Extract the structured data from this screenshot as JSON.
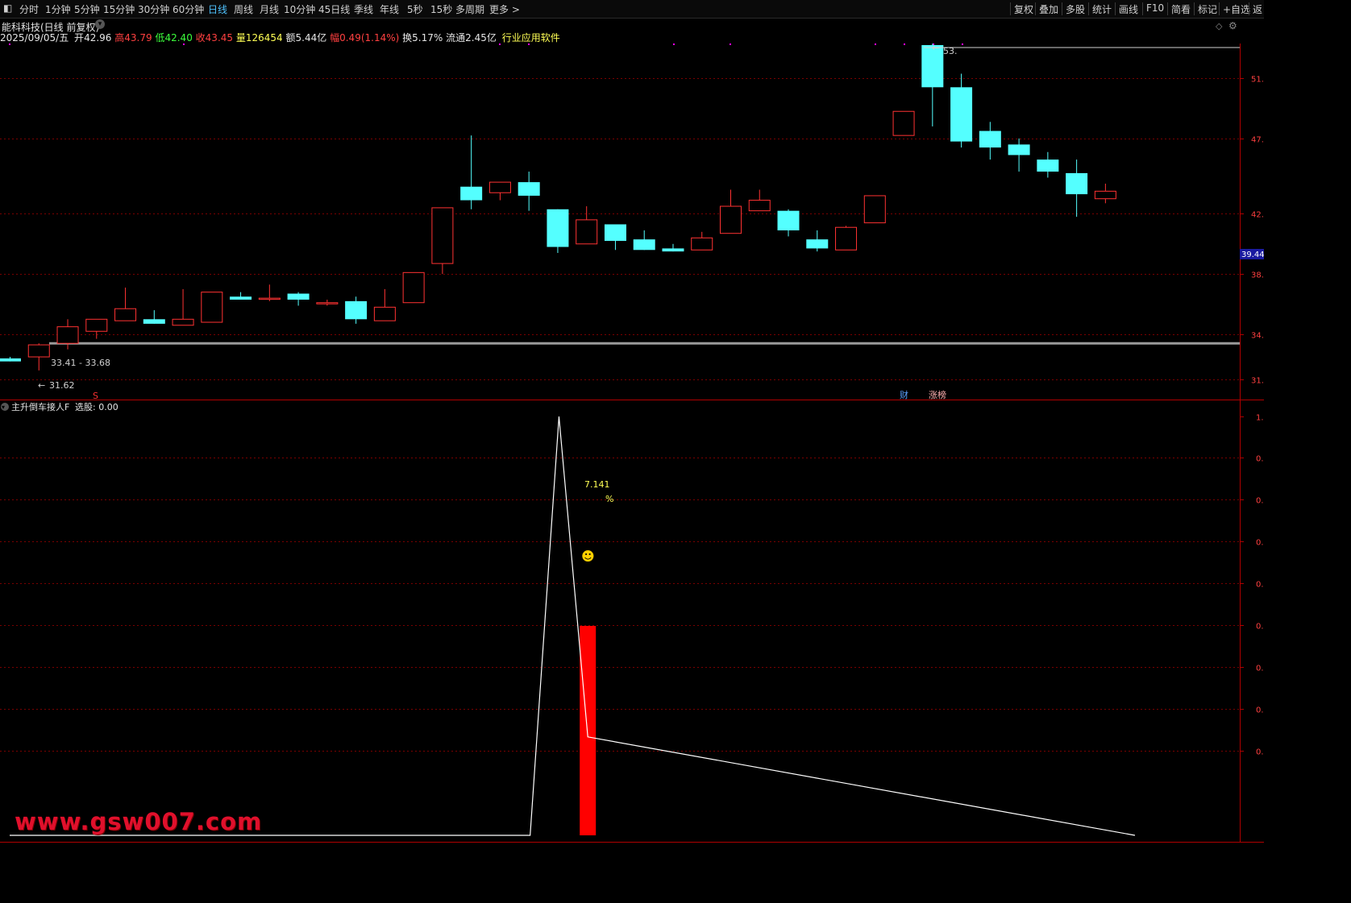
{
  "toolbar": {
    "menu_icon": "square-menu-icon",
    "periods": [
      "分时",
      "1分钟",
      "5分钟",
      "15分钟",
      "30分钟",
      "60分钟",
      "日线",
      "周线",
      "月线",
      "10分钟",
      "45日线",
      "季线",
      "年线",
      "5秒",
      "15秒",
      "多周期",
      "更多 >"
    ],
    "active_period": "日线",
    "right_buttons": [
      "复权",
      "叠加",
      "多股",
      "统计",
      "画线",
      "F10",
      "简看",
      "标记",
      "+自选",
      "返"
    ]
  },
  "header": {
    "stock_title": "能科科技(日线 前复权)",
    "date": "2025/09/05/五",
    "open_label": "开",
    "open": "42.96",
    "high_label": "高",
    "high": "43.79",
    "low_label": "低",
    "low": "42.40",
    "close_label": "收",
    "close": "43.45",
    "volume_label": "量",
    "volume": "126454",
    "amount_label": "额",
    "amount": "5.44亿",
    "change_label": "幅",
    "change": "0.49(1.14%)",
    "turnover_label": "换",
    "turnover": "5.17%",
    "float_label": "流通",
    "float": "2.45亿",
    "industry": "行业应用软件"
  },
  "main_panel": {
    "hline_label": "33.41 - 33.68",
    "low_marker": "31.62",
    "high_marker": "53.",
    "s_marker": "S",
    "cai_marker": "财",
    "zhangbang_marker": "涨榜",
    "current_price_tag": "39.44",
    "price_axis_labels": [
      "51.",
      "47.",
      "42.",
      "38.",
      "34.",
      "31."
    ]
  },
  "indicator": {
    "name": "主升倒车接人F",
    "select_label": "选股: 0.00",
    "value_label": "7.141",
    "percent_label": "%",
    "smiley": "☻",
    "axis_labels": [
      "1.",
      "0.",
      "0.",
      "0.",
      "0.",
      "0.",
      "0.",
      "0.",
      "0."
    ]
  },
  "watermark": "www.gsw007.com",
  "colors": {
    "up": "#ff3232",
    "down": "#54ffff",
    "bar": "#ff0000",
    "axis": "#b00000",
    "grid": "#7a0000",
    "indicator_line": "#ffffff",
    "label_yellow": "#ffff55"
  },
  "chart_data": [
    {
      "type": "candlestick",
      "title": "能科科技(日线 前复权)",
      "y_axis_ticks": [
        51,
        47,
        42,
        38,
        34,
        31
      ],
      "ylim": [
        31,
        53.3
      ],
      "horizontal_line": 33.4,
      "candles": [
        {
          "o": 32.4,
          "h": 32.5,
          "l": 32.2,
          "c": 32.2
        },
        {
          "o": 32.5,
          "h": 33.4,
          "l": 31.6,
          "c": 33.3
        },
        {
          "o": 33.4,
          "h": 35.0,
          "l": 33.0,
          "c": 34.5
        },
        {
          "o": 34.2,
          "h": 35.0,
          "l": 33.7,
          "c": 35.0
        },
        {
          "o": 34.9,
          "h": 37.1,
          "l": 34.9,
          "c": 35.7
        },
        {
          "o": 35.0,
          "h": 35.6,
          "l": 34.8,
          "c": 34.7
        },
        {
          "o": 34.6,
          "h": 37.0,
          "l": 34.6,
          "c": 35.0
        },
        {
          "o": 34.8,
          "h": 36.8,
          "l": 34.8,
          "c": 36.8
        },
        {
          "o": 36.5,
          "h": 36.8,
          "l": 36.3,
          "c": 36.3
        },
        {
          "o": 36.4,
          "h": 37.3,
          "l": 36.2,
          "c": 36.4
        },
        {
          "o": 36.7,
          "h": 36.8,
          "l": 35.9,
          "c": 36.3
        },
        {
          "o": 36.1,
          "h": 36.3,
          "l": 35.9,
          "c": 36.1
        },
        {
          "o": 36.2,
          "h": 36.5,
          "l": 34.7,
          "c": 35.0
        },
        {
          "o": 34.9,
          "h": 37.0,
          "l": 34.9,
          "c": 35.8
        },
        {
          "o": 36.1,
          "h": 38.1,
          "l": 36.1,
          "c": 38.1
        },
        {
          "o": 38.7,
          "h": 42.4,
          "l": 38.0,
          "c": 42.4
        },
        {
          "o": 43.8,
          "h": 47.2,
          "l": 42.3,
          "c": 42.9
        },
        {
          "o": 43.4,
          "h": 43.9,
          "l": 42.9,
          "c": 44.1
        },
        {
          "o": 44.1,
          "h": 44.8,
          "l": 42.2,
          "c": 43.2
        },
        {
          "o": 42.3,
          "h": 42.3,
          "l": 39.4,
          "c": 39.8
        },
        {
          "o": 40.0,
          "h": 42.5,
          "l": 40.1,
          "c": 41.6
        },
        {
          "o": 41.3,
          "h": 41.3,
          "l": 39.6,
          "c": 40.2
        },
        {
          "o": 40.3,
          "h": 40.9,
          "l": 39.8,
          "c": 39.6
        },
        {
          "o": 39.7,
          "h": 40.0,
          "l": 39.5,
          "c": 39.5
        },
        {
          "o": 39.6,
          "h": 40.8,
          "l": 39.6,
          "c": 40.4
        },
        {
          "o": 40.7,
          "h": 43.6,
          "l": 40.7,
          "c": 42.5
        },
        {
          "o": 42.2,
          "h": 43.6,
          "l": 42.2,
          "c": 42.9
        },
        {
          "o": 42.2,
          "h": 42.3,
          "l": 40.5,
          "c": 40.9
        },
        {
          "o": 40.3,
          "h": 40.9,
          "l": 39.5,
          "c": 39.7
        },
        {
          "o": 39.6,
          "h": 41.2,
          "l": 39.6,
          "c": 41.1
        },
        {
          "o": 41.4,
          "h": 43.2,
          "l": 41.4,
          "c": 43.2
        },
        {
          "o": 47.2,
          "h": 48.6,
          "l": 47.2,
          "c": 48.8
        },
        {
          "o": 53.2,
          "h": 53.3,
          "l": 47.8,
          "c": 50.4
        },
        {
          "o": 50.4,
          "h": 51.3,
          "l": 46.4,
          "c": 46.8
        },
        {
          "o": 47.5,
          "h": 48.1,
          "l": 45.6,
          "c": 46.4
        },
        {
          "o": 46.6,
          "h": 47.0,
          "l": 44.8,
          "c": 45.9
        },
        {
          "o": 45.6,
          "h": 46.1,
          "l": 44.4,
          "c": 44.8
        },
        {
          "o": 44.7,
          "h": 45.6,
          "l": 41.8,
          "c": 43.3
        },
        {
          "o": 43.0,
          "h": 44.0,
          "l": 42.7,
          "c": 43.5
        }
      ]
    },
    {
      "type": "line",
      "title": "主升倒车接人F",
      "ylim": [
        0,
        1
      ],
      "series": [
        {
          "points": [
            [
              0,
              0
            ],
            [
              18,
              0
            ],
            [
              19,
              1
            ],
            [
              20,
              0.235
            ],
            [
              39,
              0
            ]
          ]
        }
      ],
      "bars": [
        {
          "x": 20,
          "value": 0.5
        }
      ]
    }
  ]
}
